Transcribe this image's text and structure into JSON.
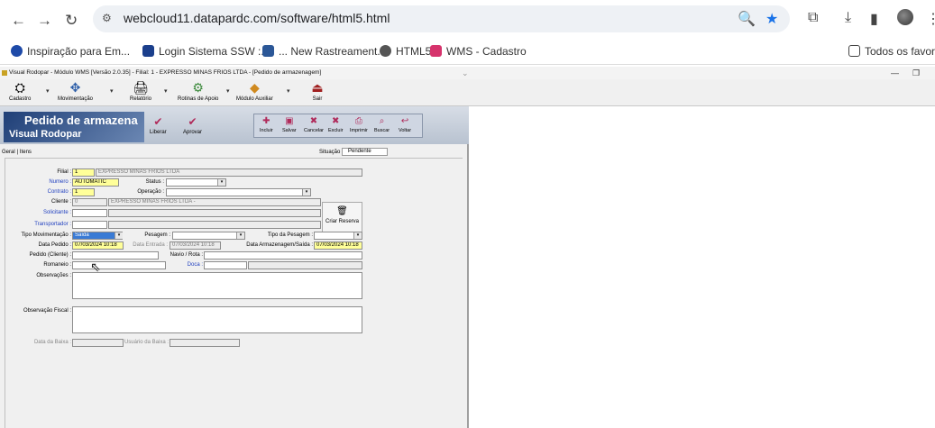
{
  "browser": {
    "url": "webcloud11.datapardc.com/software/html5.html",
    "bookmarks": [
      "Inspiração para Em...",
      "Login Sistema SSW :...",
      "... New Rastreament...",
      "HTML5",
      "WMS - Cadastro"
    ],
    "other_bookmarks": "Todos os favorito"
  },
  "app": {
    "title": "Visual Rodopar - Módulo WMS [Versão 2.0.35] - Filial: 1 - EXPRESSO MINAS FRIOS LTDA - [Pedido de armazenagem]",
    "toolbar": [
      "Cadastro",
      "Movimentação",
      "Relatório",
      "Rotinas de Apoio",
      "Módulo Auxiliar",
      "Sair"
    ],
    "banner_title": "Pedido de armazena",
    "banner_sub": "Visual Rodopar",
    "banner_buttons": [
      "Liberar",
      "Aprovar"
    ],
    "group_buttons": [
      "Incluir",
      "Salvar",
      "Cancelar",
      "Excluir",
      "Imprimir",
      "Buscar",
      "Voltar"
    ],
    "tabs": [
      "Geral",
      "Itens"
    ],
    "situacao_label": "Situação :",
    "situacao_value": "Pendente"
  },
  "form": {
    "filial_label": "Filial :",
    "filial_code": "1",
    "filial_name": "EXPRESSO MINAS FRIOS LTDA",
    "numero_label": "Numero :",
    "numero_value": "AUTOMATIC",
    "status_label": "Status :",
    "contrato_label": "Contrato :",
    "contrato_value": "1",
    "operacao_label": "Operação :",
    "cliente_label": "Cliente :",
    "cliente_code": "0",
    "cliente_name": "EXPRESSO MINAS FRIOS LTDA -",
    "solicitante_label": "Solicitante :",
    "transportador_label": "Transportador :",
    "criar_reserva": "Criar Reserva",
    "tipo_mov_label": "Tipo Movimentação :",
    "tipo_mov_value": "Saída",
    "pesagem_label": "Pesagem :",
    "tipo_pesagem_label": "Tipo da Pesagem :",
    "data_pedido_label": "Data Pedido :",
    "data_pedido_value": "07/03/2024 10:18",
    "data_entrada_label": "Data Entrada :",
    "data_entrada_value": "07/03/2024 10:18",
    "data_arm_label": "Data Armazenagem/Saída :",
    "data_arm_value": "07/03/2024 10:18",
    "pedido_cliente_label": "Pedido (Cliente) :",
    "navio_label": "Navio / Rota :",
    "romaneio_label": "Romaneio :",
    "doca_label": "Doca :",
    "observacoes_label": "Observações :",
    "obs_fiscal_label": "Observação Fiscal :",
    "data_baixa_label": "Data da Baixa :",
    "usuario_baixa_label": "Usuário da Baixa :"
  }
}
